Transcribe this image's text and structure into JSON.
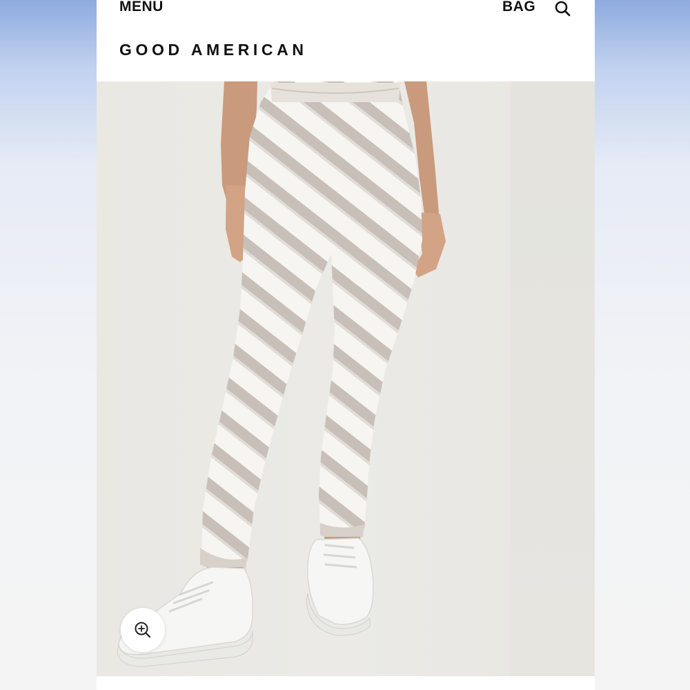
{
  "header": {
    "menu_label": "MENU",
    "bag_label": "BAG",
    "brand": "GOOD AMERICAN",
    "search_icon": "search-icon"
  },
  "product": {
    "image_alt": "Tie-dye sweatpants product photo",
    "zoom_icon": "zoom-in-icon"
  },
  "colors": {
    "text": "#111111",
    "background_gradient_top": "#8eaadf",
    "page_white": "#ffffff",
    "photo_backdrop": "#eae9e4",
    "pants_stripe": "#b7ada3"
  }
}
